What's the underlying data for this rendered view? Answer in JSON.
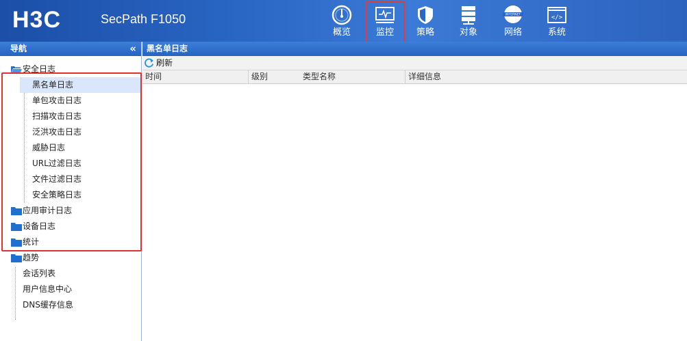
{
  "header": {
    "logo": "H3C",
    "product": "SecPath F1050",
    "nav": [
      {
        "label": "概览",
        "icon": "gauge-icon"
      },
      {
        "label": "监控",
        "icon": "monitor-icon",
        "active": true
      },
      {
        "label": "策略",
        "icon": "shield-icon"
      },
      {
        "label": "对象",
        "icon": "server-icon"
      },
      {
        "label": "网络",
        "icon": "internet-icon"
      },
      {
        "label": "系统",
        "icon": "code-window-icon"
      }
    ]
  },
  "sidebar": {
    "title": "导航",
    "collapse_symbol": "«",
    "tree": {
      "security_log": "安全日志",
      "security_children": [
        "黑名单日志",
        "单包攻击日志",
        "扫描攻击日志",
        "泛洪攻击日志",
        "威胁日志",
        "URL过滤日志",
        "文件过滤日志",
        "安全策略日志"
      ],
      "app_audit_log": "应用审计日志",
      "device_log": "设备日志",
      "stats": "统计",
      "trend": "趋势",
      "trend_children": [
        "会话列表",
        "用户信息中心",
        "DNS缓存信息"
      ]
    },
    "selected": "黑名单日志"
  },
  "main": {
    "title": "黑名单日志",
    "refresh_label": "刷新",
    "columns": [
      "时间",
      "级别",
      "类型名称",
      "详细信息"
    ]
  },
  "colors": {
    "header_blue": "#2a66c4",
    "highlight_red": "#e03030",
    "selected_bg": "#d9e6fb",
    "folder_blue": "#1f6fd0"
  }
}
